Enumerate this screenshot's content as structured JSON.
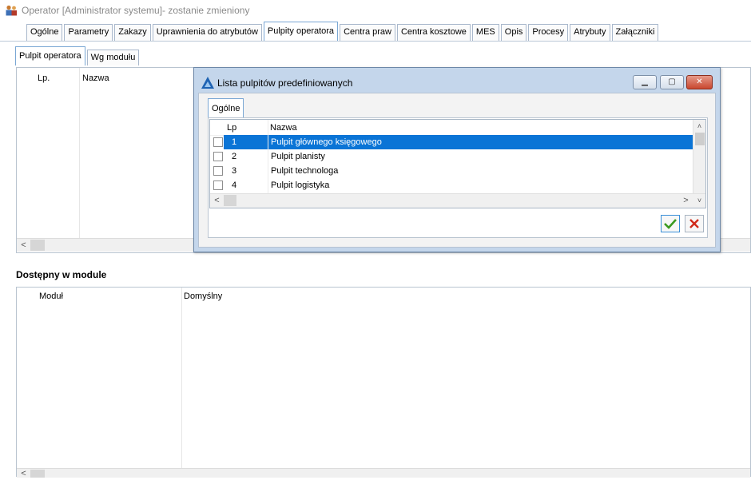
{
  "window": {
    "title": "Operator [Administrator systemu]- zostanie zmieniony",
    "icon": "users-icon"
  },
  "main_tabs": [
    {
      "label": "Ogólne",
      "active": false
    },
    {
      "label": "Parametry",
      "active": false
    },
    {
      "label": "Zakazy",
      "active": false
    },
    {
      "label": "Uprawnienia do atrybutów",
      "active": false
    },
    {
      "label": "Pulpity operatora",
      "active": true
    },
    {
      "label": "Centra praw",
      "active": false
    },
    {
      "label": "Centra kosztowe",
      "active": false
    },
    {
      "label": "MES",
      "active": false
    },
    {
      "label": "Opis",
      "active": false
    },
    {
      "label": "Procesy",
      "active": false
    },
    {
      "label": "Atrybuty",
      "active": false
    },
    {
      "label": "Załączniki",
      "active": false
    }
  ],
  "sub_tabs": [
    {
      "label": "Pulpit operatora",
      "active": true
    },
    {
      "label": "Wg modułu",
      "active": false
    }
  ],
  "upper_grid": {
    "columns": [
      "Lp.",
      "Nazwa"
    ]
  },
  "section_label": "Dostępny w module",
  "lower_grid": {
    "columns": [
      "Moduł",
      "Domyślny"
    ]
  },
  "dialog": {
    "title": "Lista pulpitów predefiniowanych",
    "tab": "Ogólne",
    "columns": [
      "Lp",
      "Nazwa"
    ],
    "rows": [
      {
        "lp": "1",
        "name": "Pulpit głównego księgowego",
        "selected": true,
        "checked": false
      },
      {
        "lp": "2",
        "name": "Pulpit planisty",
        "selected": false,
        "checked": false
      },
      {
        "lp": "3",
        "name": "Pulpit technologa",
        "selected": false,
        "checked": false
      },
      {
        "lp": "4",
        "name": "Pulpit logistyka",
        "selected": false,
        "checked": false
      }
    ],
    "colors": {
      "selection": "#0a74d6",
      "ok": "#3a9a20",
      "cancel": "#d02a1a"
    }
  }
}
